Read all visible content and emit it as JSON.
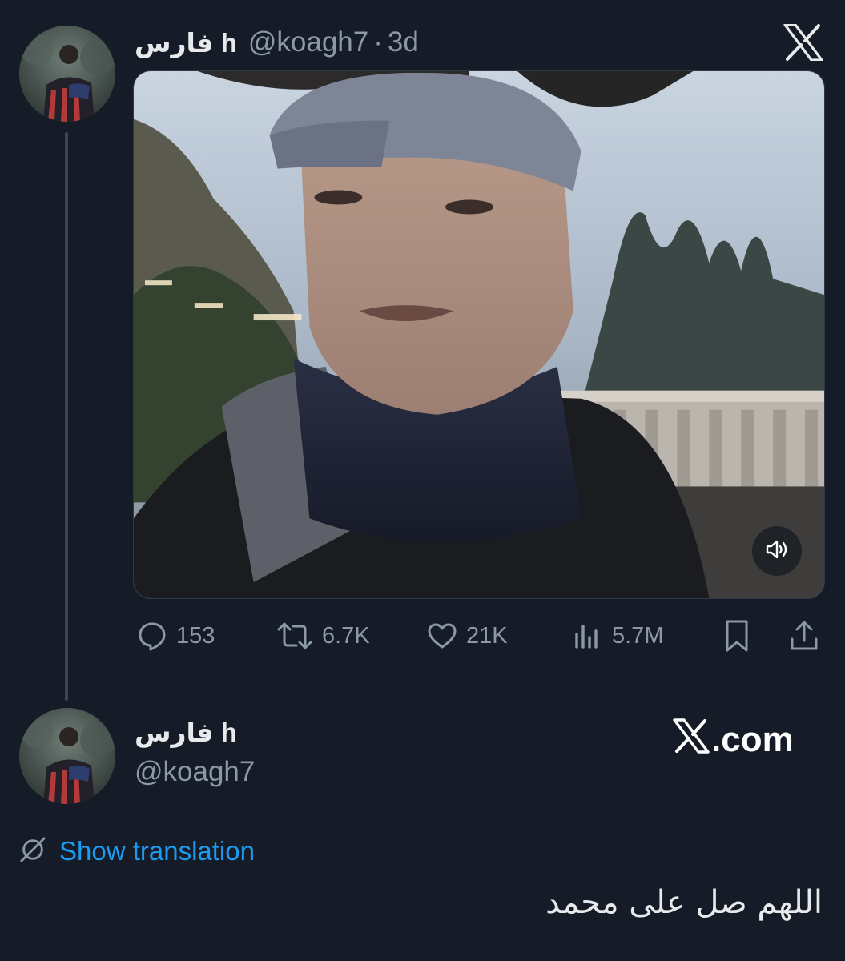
{
  "tweet": {
    "display_name": "فارس h",
    "handle": "@koagh7",
    "separator": "·",
    "time": "3d",
    "stats": {
      "replies": "153",
      "retweets": "6.7K",
      "likes": "21K",
      "views": "5.7M"
    }
  },
  "quote_card": {
    "display_name": "فارس h",
    "handle": "@koagh7",
    "brand": ".com",
    "translate_label": "Show translation",
    "text": "اللهم صل على محمد"
  },
  "colors": {
    "background": "#161c27",
    "text": "#e7e9ea",
    "muted": "#8b98a5",
    "link": "#1d9bf0"
  },
  "icons": {
    "logo": "x-logo-icon",
    "reply": "reply-icon",
    "retweet": "retweet-icon",
    "like": "heart-icon",
    "views": "views-icon",
    "bookmark": "bookmark-icon",
    "share": "share-icon",
    "sound": "speaker-icon",
    "translate": "globe-slash-icon"
  }
}
